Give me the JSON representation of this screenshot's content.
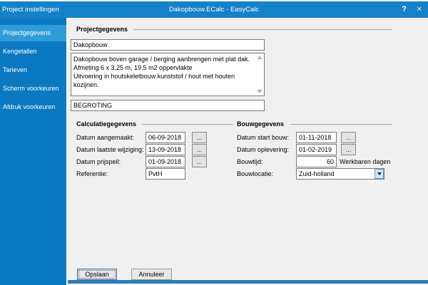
{
  "window": {
    "title_left": "Project instellingen",
    "title_center": "Dakopbouw.ECalc  -  EasyCalc",
    "help_icon": "?",
    "close_icon": "✕"
  },
  "sidebar": {
    "items": [
      {
        "label": "Projectgegevens",
        "selected": true
      },
      {
        "label": "Kengetallen",
        "selected": false
      },
      {
        "label": "Tarieven",
        "selected": false
      },
      {
        "label": "Scherm voorkeuren",
        "selected": false
      },
      {
        "label": "Afdruk voorkeuren",
        "selected": false
      }
    ]
  },
  "project_group": {
    "title": "Projectgegevens",
    "name_value": "Dakopbouw",
    "description_value": "Dakopbouw boven garage / berging aanbrengen met plat dak.\nAfmeting 6 x 3,25 m, 19,5 m2 oppervlakte\nUitvoering in houtskeletbouw kunststof / hout met houten kozijnen.",
    "type_value": "BEGROTING"
  },
  "calculatie_group": {
    "title": "Calculatiegegevens",
    "rows": [
      {
        "label": "Datum aangemaakt:",
        "value": "06-09-2018"
      },
      {
        "label": "Datum laatste wijziging:",
        "value": "13-09-2018"
      },
      {
        "label": "Datum prijspeil:",
        "value": "01-09-2018"
      },
      {
        "label": "Referentie:",
        "value": "PvtH"
      }
    ]
  },
  "bouw_group": {
    "title": "Bouwgegevens",
    "rows": [
      {
        "label": "Datum start bouw:",
        "value": "01-11-2018"
      },
      {
        "label": "Datum oplevering:",
        "value": "01-02-2019"
      },
      {
        "label": "Bouwtijd:",
        "value": "60",
        "suffix": "Werkbaren dagen"
      },
      {
        "label": "Bouwlocatie:",
        "value": "Zuid-holland"
      }
    ]
  },
  "footer": {
    "save_label": "Opslaan",
    "cancel_label": "Annuleer"
  },
  "icons": {
    "ellipsis": "..."
  },
  "colors": {
    "titlebar_bg": "#1481c8",
    "sidebar_bg": "#0a79c1",
    "selected_bg": "#2f9cd8",
    "content_bg": "#f0f0f0",
    "accent_bar": "#2f7cb8",
    "input_border": "#7a7a7a"
  }
}
